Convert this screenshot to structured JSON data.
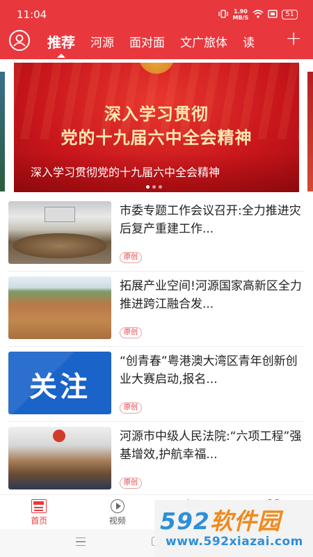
{
  "status_bar": {
    "time": "11:04",
    "net_speed_value": "1.90",
    "net_speed_unit": "MB/S",
    "battery": "51"
  },
  "header": {
    "tabs": [
      "推荐",
      "河源",
      "面对面",
      "文广旅体",
      "读"
    ],
    "active_tab_index": 0,
    "add_symbol": "+"
  },
  "banner": {
    "image_title_line1": "深入学习贯彻",
    "image_title_line2": "党的十九届六中全会精神",
    "caption": "深入学习贯彻党的十九届六中全会精神",
    "dot_count": 3,
    "active_dot": 0
  },
  "news": [
    {
      "title": "市委专题工作会议召开:全力推进灾后复产重建工作...",
      "tag": "原创",
      "thumb": "meeting-room-photo"
    },
    {
      "title": "拓展产业空间!河源国家高新区全力推进跨江融合发...",
      "tag": "原创",
      "thumb": "construction-site-photo"
    },
    {
      "title": "“创青春”粤港澳大湾区青年创新创业大赛启动,报名...",
      "tag": "原创",
      "thumb": "guanzhu-graphic",
      "thumb_text": "关注"
    },
    {
      "title": "河源市中级人民法院:“六项工程”强基增效,护航幸福...",
      "tag": "原创",
      "thumb": "court-meeting-photo"
    }
  ],
  "bottom_nav": {
    "items": [
      {
        "label": "首页",
        "icon": "news-icon",
        "active": true
      },
      {
        "label": "视频",
        "icon": "video-icon",
        "active": false
      },
      {
        "label": "",
        "icon": "flag-icon",
        "active": false
      },
      {
        "label": "",
        "icon": "service-grid-icon",
        "active": false
      }
    ]
  },
  "watermark": {
    "logo_number": "592",
    "logo_text": "软件园",
    "url": "www.592xiazai.com"
  },
  "colors": {
    "brand_red": "#e8383d",
    "tag_red": "#e8383d",
    "watermark_blue": "#2d8fd8",
    "watermark_orange": "#f08a1c"
  }
}
